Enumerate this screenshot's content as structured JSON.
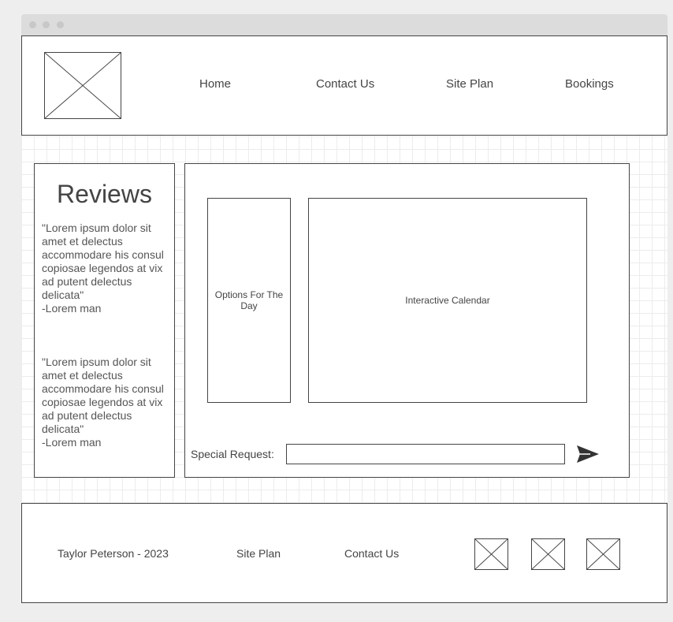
{
  "header": {
    "nav": {
      "home": "Home",
      "contact": "Contact Us",
      "site_plan": "Site Plan",
      "bookings": "Bookings"
    }
  },
  "reviews": {
    "title": "Reviews",
    "items": [
      {
        "quote": "\"Lorem ipsum dolor sit amet et delectus accommodare his consul copiosae legendos at vix ad putent delectus delicata\"",
        "author": "-Lorem man"
      },
      {
        "quote": "\"Lorem ipsum dolor sit amet et delectus accommodare his consul copiosae legendos at vix ad putent delectus delicata\"",
        "author": "-Lorem man"
      }
    ]
  },
  "booking": {
    "options_label": "Options For The Day",
    "calendar_label": "Interactive Calendar",
    "request_label": "Special Request:",
    "request_value": ""
  },
  "footer": {
    "copyright": "Taylor Peterson - 2023",
    "site_plan": "Site Plan",
    "contact": "Contact Us"
  },
  "icons": {
    "logo": "image-placeholder-icon",
    "send": "send-arrow-icon",
    "social": [
      "image-placeholder-icon",
      "image-placeholder-icon",
      "image-placeholder-icon"
    ]
  }
}
